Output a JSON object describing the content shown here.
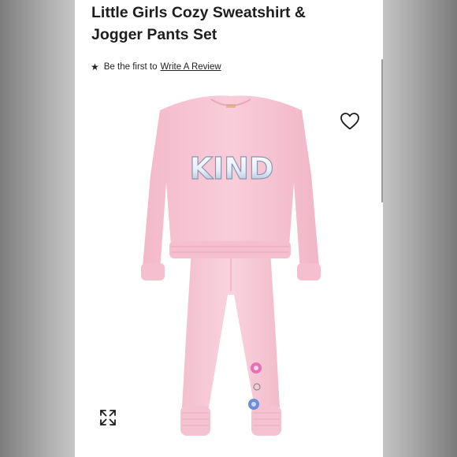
{
  "product": {
    "title": "Little Girls Cozy Sweatshirt & Jogger Pants Set",
    "image_text": "KIND"
  },
  "review": {
    "star_icon": "★",
    "prefix": "Be the first to",
    "link": "Write A Review"
  },
  "actions": {
    "wishlist_icon": "heart-outline-icon",
    "expand_icon": "expand-arrows-icon"
  },
  "colors": {
    "garment_pink": "#f6c6d3",
    "text": "#1e1e1e"
  }
}
